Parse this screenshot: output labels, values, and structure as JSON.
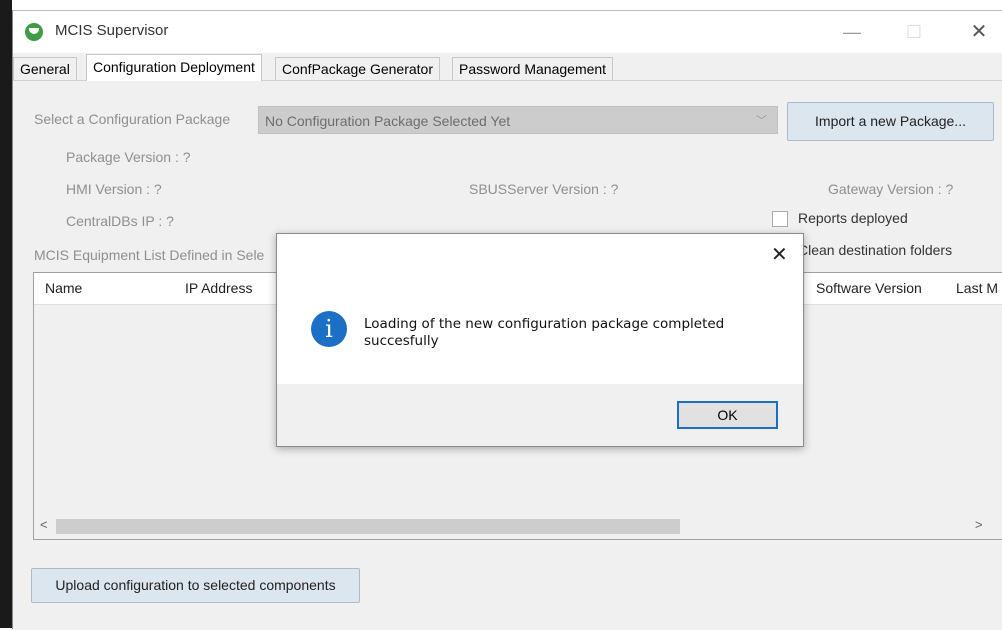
{
  "window": {
    "title": "MCIS Supervisor",
    "controls": {
      "minimize": "—",
      "maximize": "☐",
      "close": "✕"
    }
  },
  "tabs": [
    "General",
    "Configuration Deployment",
    "ConfPackage Generator",
    "Password Management"
  ],
  "deployment": {
    "select_label": "Select a Configuration Package",
    "combo_value": "No Configuration Package Selected Yet",
    "import_button": "Import a new Package...",
    "package_version": "Package Version : ?",
    "hmi_version": "HMI Version : ?",
    "sbus_version": "SBUSServer Version : ?",
    "gateway_version": "Gateway Version : ?",
    "centraldbs_ip": "CentralDBs IP : ?",
    "reports_deployed": "Reports deployed",
    "clean_folders": "Clean destination folders",
    "equipment_list_label": "MCIS Equipment List Defined in Sele",
    "columns": [
      "Name",
      "IP Address",
      "Software Version",
      "Last M"
    ],
    "upload_button": "Upload configuration to selected components"
  },
  "scroll": {
    "left": "<",
    "right": ">"
  },
  "dialog": {
    "close": "✕",
    "icon": "i",
    "message": "Loading of the new configuration package completed succesfully",
    "ok_button": "OK"
  }
}
